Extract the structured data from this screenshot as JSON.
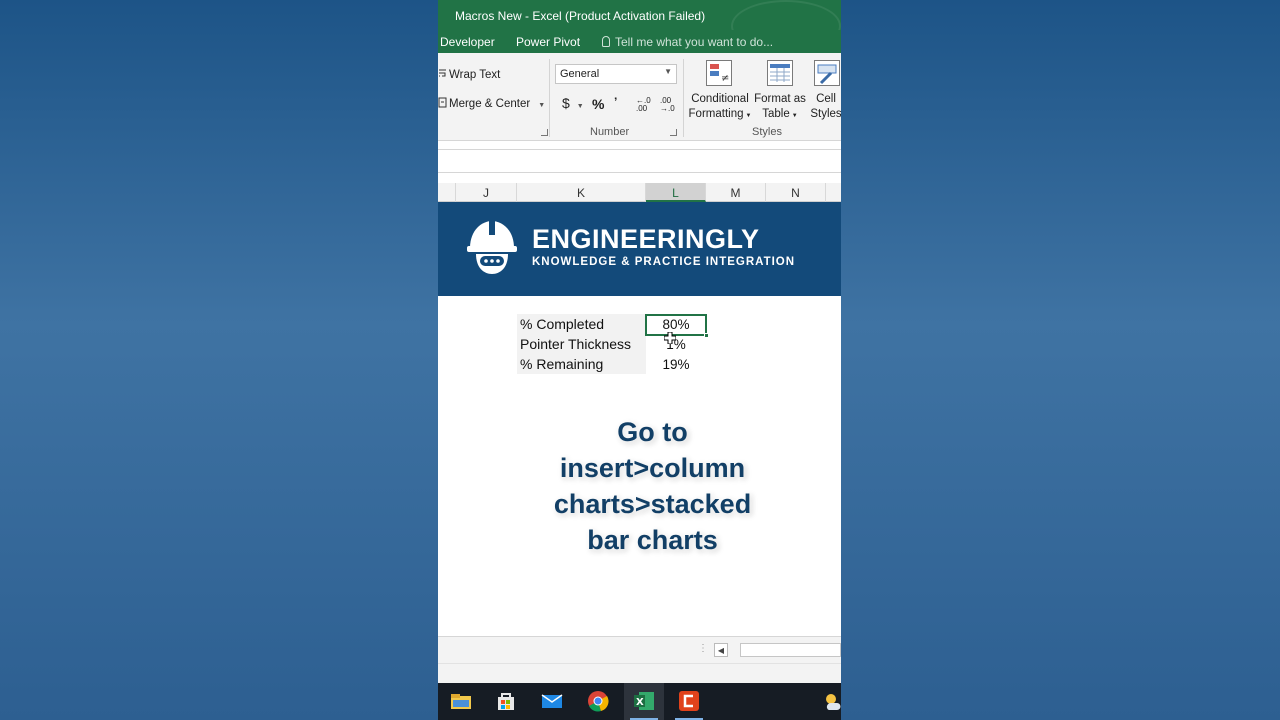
{
  "window": {
    "title": "Macros New - Excel (Product Activation Failed)"
  },
  "ribbon_tabs": [
    {
      "label": "Developer"
    },
    {
      "label": "Power Pivot"
    }
  ],
  "tell_me": {
    "placeholder": "Tell me what you want to do..."
  },
  "alignment": {
    "wrap_text": "Wrap Text",
    "merge_center": "Merge & Center"
  },
  "number": {
    "format_value": "General",
    "currency_symbol": "$",
    "percent_symbol": "%",
    "comma_symbol": "ʼ",
    "increase_decimal": "←.0 .00",
    "decrease_decimal": ".00 →.0",
    "group_label": "Number"
  },
  "styles": {
    "conditional_formatting": [
      "Conditional",
      "Formatting"
    ],
    "format_as_table": [
      "Format as",
      "Table"
    ],
    "cell_styles": [
      "Cell",
      "Styles"
    ],
    "group_label": "Styles"
  },
  "columns": [
    "J",
    "K",
    "L",
    "M",
    "N"
  ],
  "selected_column": "L",
  "banner": {
    "brand": "ENGINEERINGLY",
    "tagline": "KNOWLEDGE & PRACTICE INTEGRATION"
  },
  "rows": [
    {
      "label": "% Completed",
      "value": "80%"
    },
    {
      "label": "Pointer Thickness",
      "value": "1%"
    },
    {
      "label": "% Remaining",
      "value": "19%"
    }
  ],
  "overlay_text": [
    "Go to",
    "insert>column",
    "charts>stacked",
    "bar charts"
  ],
  "taskbar": {
    "apps": [
      "file-explorer-icon",
      "store-icon",
      "mail-icon",
      "chrome-icon",
      "excel-icon",
      "recorder-icon",
      "weather-icon"
    ],
    "active_app": "excel-icon"
  },
  "colors": {
    "excel_green": "#217346",
    "banner_blue": "#134a7a",
    "overlay_text": "#123f66",
    "taskbar": "#161c24"
  }
}
